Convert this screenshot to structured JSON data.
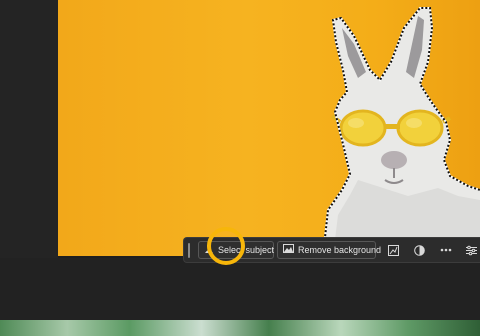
{
  "toolbar": {
    "select_subject_label": "Select subject",
    "remove_background_label": "Remove background",
    "icons": [
      "person-select-icon",
      "image-icon",
      "adjust-icon",
      "contrast-icon",
      "more-icon",
      "sliders-icon"
    ]
  },
  "colors": {
    "photo_background": "#f4ad18",
    "toolbar_background": "#2c2c2c",
    "highlight_ring": "#f7b60a",
    "sunglasses": "#f2d13b",
    "app_background": "#1f1f1f"
  },
  "canvas": {
    "subject": "white-rabbit-with-yellow-sunglasses"
  }
}
